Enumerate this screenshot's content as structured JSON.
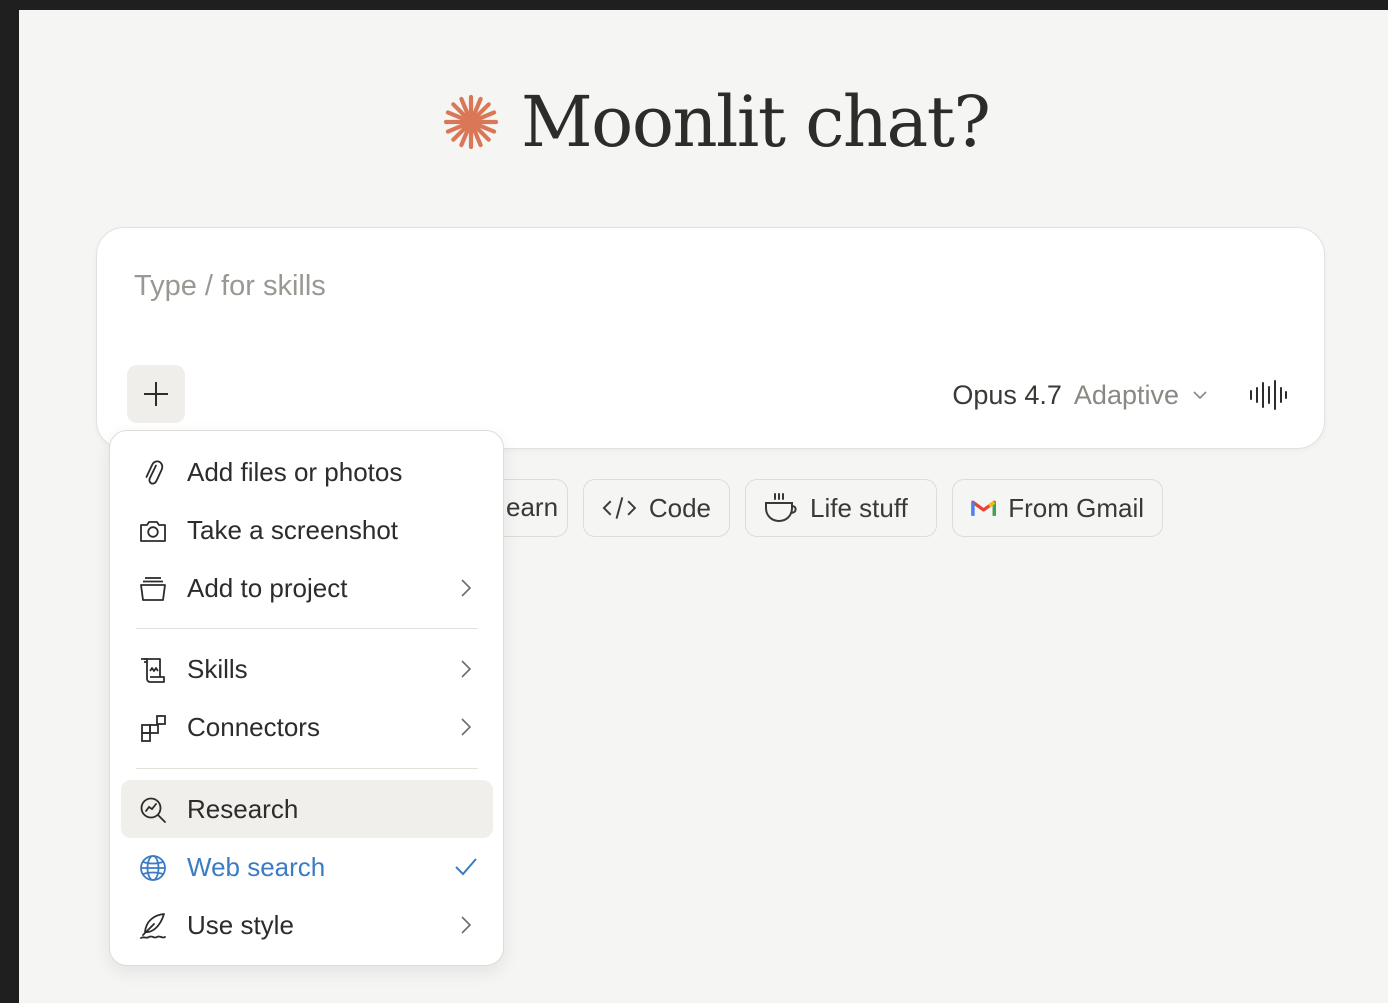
{
  "title": {
    "text": "Moonlit chat?",
    "accent_color": "#d97757"
  },
  "composer": {
    "placeholder": "Type / for skills",
    "value": "",
    "plus_icon": "plus-icon",
    "model": {
      "name": "Opus 4.7",
      "mode": "Adaptive"
    },
    "voice_icon": "waveform-icon"
  },
  "chips": [
    {
      "label": "Learn",
      "visible_label": "earn",
      "icon": "book-icon"
    },
    {
      "label": "Code",
      "icon": "code-icon"
    },
    {
      "label": "Life stuff",
      "icon": "coffee-cup-icon"
    },
    {
      "label": "From Gmail",
      "icon": "gmail-icon"
    }
  ],
  "menu": {
    "items": [
      {
        "label": "Add files or photos",
        "icon": "paperclip-icon",
        "trailing": ""
      },
      {
        "label": "Take a screenshot",
        "icon": "camera-icon",
        "trailing": ""
      },
      {
        "label": "Add to project",
        "icon": "project-box-icon",
        "trailing": "chevron-right"
      },
      {
        "label": "Skills",
        "icon": "scroll-icon",
        "trailing": "chevron-right"
      },
      {
        "label": "Connectors",
        "icon": "blocks-icon",
        "trailing": "chevron-right"
      },
      {
        "label": "Research",
        "icon": "research-icon",
        "trailing": "",
        "highlighted": true
      },
      {
        "label": "Web search",
        "icon": "globe-icon",
        "trailing": "check",
        "active": true,
        "active_color": "#3b7cc4"
      },
      {
        "label": "Use style",
        "icon": "quill-icon",
        "trailing": "chevron-right"
      }
    ]
  }
}
